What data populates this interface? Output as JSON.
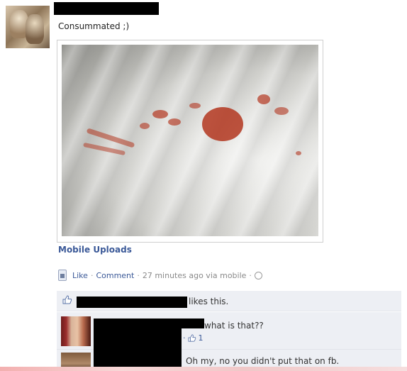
{
  "post": {
    "status_text": "Consummated ;)",
    "album_link": "Mobile Uploads",
    "actions": {
      "like": "Like",
      "comment": "Comment",
      "timestamp": "27 minutes ago via mobile",
      "separator": "·"
    }
  },
  "likes_bar": {
    "text": "likes this."
  },
  "comments": [
    {
      "text": "what is that??",
      "likes": "1"
    },
    {
      "text": "Oh my, no you didn't put that on fb."
    }
  ],
  "icons": {
    "mobile": "mobile-upload-icon",
    "globe": "globe-icon",
    "thumb": "thumbs-up-icon"
  },
  "colors": {
    "link": "#3b5998",
    "comment_bg": "#edeff4",
    "redaction": "#000000"
  }
}
